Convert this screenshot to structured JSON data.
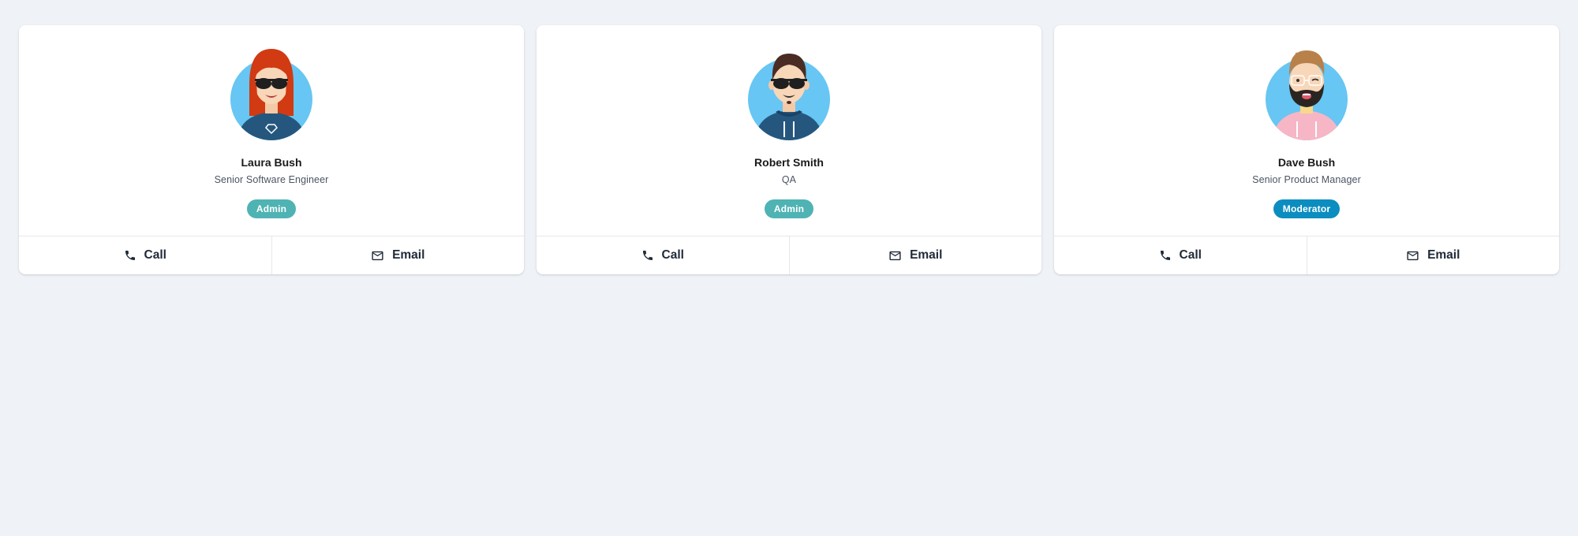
{
  "colors": {
    "page_bg": "#eff2f6",
    "card_bg": "#ffffff",
    "avatar_bg": "#67c6f3",
    "admin_badge": "#4fb3b3",
    "moderator_badge": "#0b8dc0"
  },
  "cards": [
    {
      "name": "Laura Bush",
      "role": "Senior Software Engineer",
      "badge": "Admin",
      "badge_color": "#4fb3b3",
      "avatar_icon": "woman-red-hair-sunglasses-avatar",
      "call_label": "Call",
      "email_label": "Email"
    },
    {
      "name": "Robert Smith",
      "role": "QA",
      "badge": "Admin",
      "badge_color": "#4fb3b3",
      "avatar_icon": "man-sunglasses-hoodie-avatar",
      "call_label": "Call",
      "email_label": "Email"
    },
    {
      "name": "Dave Bush",
      "role": "Senior Product Manager",
      "badge": "Moderator",
      "badge_color": "#0b8dc0",
      "avatar_icon": "man-beard-winking-avatar",
      "call_label": "Call",
      "email_label": "Email"
    }
  ]
}
